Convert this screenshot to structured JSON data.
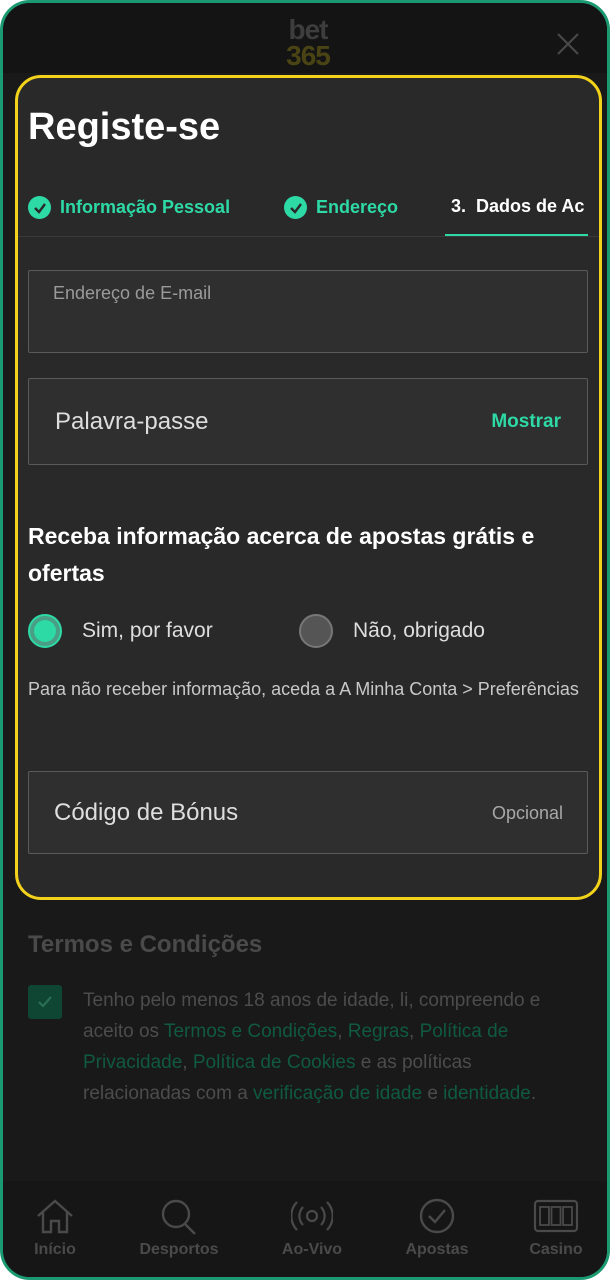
{
  "header": {
    "logo_line1": "bet",
    "logo_line2": "365"
  },
  "registration": {
    "title": "Registe-se",
    "steps": [
      {
        "label": "Informação Pessoal",
        "state": "complete"
      },
      {
        "label": "Endereço",
        "state": "complete"
      },
      {
        "label": "3.  Dados de Ac",
        "state": "active"
      }
    ],
    "email_placeholder": "Endereço de E-mail",
    "password_placeholder": "Palavra-passe",
    "show_label": "Mostrar",
    "promo_heading": "Receba informação acerca de apostas grátis e ofertas",
    "opt_in_label": "Sim, por favor",
    "opt_out_label": "Não, obrigado",
    "selected_option": "Sim, por favor",
    "opt_note": "Para não receber informação, aceda a A Minha Conta > Preferências",
    "bonus_placeholder": "Código de Bónus",
    "bonus_optional": "Opcional"
  },
  "terms": {
    "title": "Termos e Condições",
    "checked": true,
    "text_1": "Tenho pelo menos 18 anos de idade, li, compreendo e aceito os ",
    "link_terms": "Termos e Condições",
    "sep_1": ", ",
    "link_rules": "Regras",
    "sep_2": ", ",
    "link_privacy": "Política de Privacidade",
    "sep_3": ", ",
    "link_cookies": "Política de Cookies",
    "text_2": " e as políticas relacionadas com a ",
    "link_verification": "verificação de idade",
    "text_3": " e ",
    "link_identity": "identidade",
    "text_4": "."
  },
  "bottom_nav": [
    {
      "label": "Início",
      "icon": "home-icon"
    },
    {
      "label": "Desportos",
      "icon": "search-icon"
    },
    {
      "label": "Ao-Vivo",
      "icon": "live-broadcast-icon"
    },
    {
      "label": "Apostas",
      "icon": "check-circle-icon"
    },
    {
      "label": "Casino",
      "icon": "slot-machine-icon"
    }
  ],
  "colors": {
    "accent": "#2dd9a5",
    "highlight_border": "#f2d21b",
    "frame": "#1b9a72"
  }
}
